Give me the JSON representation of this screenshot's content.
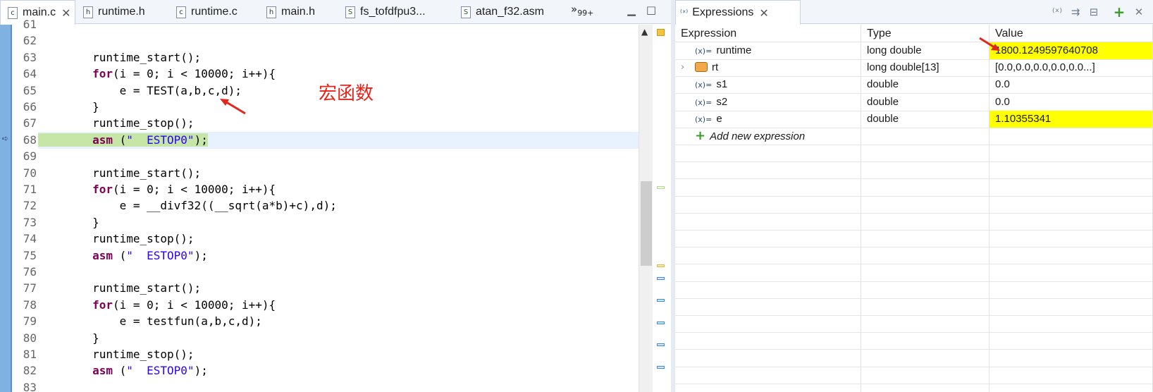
{
  "editor": {
    "tabs": [
      {
        "label": "main.c",
        "icon": "c-file-icon",
        "glyph": "c",
        "active": true
      },
      {
        "label": "runtime.h",
        "icon": "h-file-icon",
        "glyph": "h"
      },
      {
        "label": "runtime.c",
        "icon": "c-file-icon",
        "glyph": "c"
      },
      {
        "label": "main.h",
        "icon": "h-file-icon",
        "glyph": "h"
      },
      {
        "label": "fs_tofdfpu3...",
        "icon": "asm-file-icon",
        "glyph": "S"
      },
      {
        "label": "atan_f32.asm",
        "icon": "asm-file-icon",
        "glyph": "S"
      }
    ],
    "overflow_label": "»",
    "overflow_count": "99+",
    "lines": [
      {
        "num": "61",
        "indent": "",
        "kw": "",
        "pre": "",
        "str": "",
        "post": ""
      },
      {
        "num": "62",
        "indent": "",
        "kw": "",
        "pre": "",
        "str": "",
        "post": ""
      },
      {
        "num": "63",
        "indent": "        ",
        "kw": "",
        "pre": "runtime_start();",
        "str": "",
        "post": ""
      },
      {
        "num": "64",
        "indent": "        ",
        "kw": "for",
        "pre": "(i = 0; i < 10000; i++){",
        "str": "",
        "post": ""
      },
      {
        "num": "65",
        "indent": "            ",
        "kw": "",
        "pre": "e = TEST(a,b,c,d);",
        "str": "",
        "post": ""
      },
      {
        "num": "66",
        "indent": "        ",
        "kw": "",
        "pre": "}",
        "str": "",
        "post": ""
      },
      {
        "num": "67",
        "indent": "        ",
        "kw": "",
        "pre": "runtime_stop();",
        "str": "",
        "post": ""
      },
      {
        "num": "68",
        "indent": "        ",
        "kw": "asm",
        "pre": " (",
        "str": "\"  ESTOP0\"",
        "post": ");",
        "current": true
      },
      {
        "num": "69",
        "indent": "",
        "kw": "",
        "pre": "",
        "str": "",
        "post": ""
      },
      {
        "num": "70",
        "indent": "        ",
        "kw": "",
        "pre": "runtime_start();",
        "str": "",
        "post": ""
      },
      {
        "num": "71",
        "indent": "        ",
        "kw": "for",
        "pre": "(i = 0; i < 10000; i++){",
        "str": "",
        "post": ""
      },
      {
        "num": "72",
        "indent": "            ",
        "kw": "",
        "pre": "e = __divf32((__sqrt(a*b)+c),d);",
        "str": "",
        "post": ""
      },
      {
        "num": "73",
        "indent": "        ",
        "kw": "",
        "pre": "}",
        "str": "",
        "post": ""
      },
      {
        "num": "74",
        "indent": "        ",
        "kw": "",
        "pre": "runtime_stop();",
        "str": "",
        "post": ""
      },
      {
        "num": "75",
        "indent": "        ",
        "kw": "asm",
        "pre": " (",
        "str": "\"  ESTOP0\"",
        "post": ");"
      },
      {
        "num": "76",
        "indent": "",
        "kw": "",
        "pre": "",
        "str": "",
        "post": ""
      },
      {
        "num": "77",
        "indent": "        ",
        "kw": "",
        "pre": "runtime_start();",
        "str": "",
        "post": ""
      },
      {
        "num": "78",
        "indent": "        ",
        "kw": "for",
        "pre": "(i = 0; i < 10000; i++){",
        "str": "",
        "post": ""
      },
      {
        "num": "79",
        "indent": "            ",
        "kw": "",
        "pre": "e = testfun(a,b,c,d);",
        "str": "",
        "post": ""
      },
      {
        "num": "80",
        "indent": "        ",
        "kw": "",
        "pre": "}",
        "str": "",
        "post": ""
      },
      {
        "num": "81",
        "indent": "        ",
        "kw": "",
        "pre": "runtime_stop();",
        "str": "",
        "post": ""
      },
      {
        "num": "82",
        "indent": "        ",
        "kw": "asm",
        "pre": " (",
        "str": "\"  ESTOP0\"",
        "post": ");"
      },
      {
        "num": "83",
        "indent": "",
        "kw": "",
        "pre": "",
        "str": "",
        "post": ""
      }
    ],
    "annotation": "宏函数"
  },
  "expressions": {
    "tab_label": "Expressions",
    "columns": [
      "Expression",
      "Type",
      "Value"
    ],
    "rows": [
      {
        "name": "runtime",
        "type": "long double",
        "value": "1800.1249597640708",
        "changed": true,
        "kind": "variable"
      },
      {
        "name": "rt",
        "type": "long double[13]",
        "value": "[0.0,0.0,0.0,0.0,0.0...]",
        "changed": false,
        "kind": "array"
      },
      {
        "name": "s1",
        "type": "double",
        "value": "0.0",
        "changed": false,
        "kind": "variable"
      },
      {
        "name": "s2",
        "type": "double",
        "value": "0.0",
        "changed": false,
        "kind": "variable"
      },
      {
        "name": "e",
        "type": "double",
        "value": "1.10355341",
        "changed": true,
        "kind": "variable"
      }
    ],
    "add_label": "Add new expression"
  },
  "colors": {
    "changed_value": "#ffff00",
    "current_line": "#c6e6a7",
    "annotation": "#e3251b",
    "keyword": "#7f0055",
    "string": "#2a00ff"
  }
}
